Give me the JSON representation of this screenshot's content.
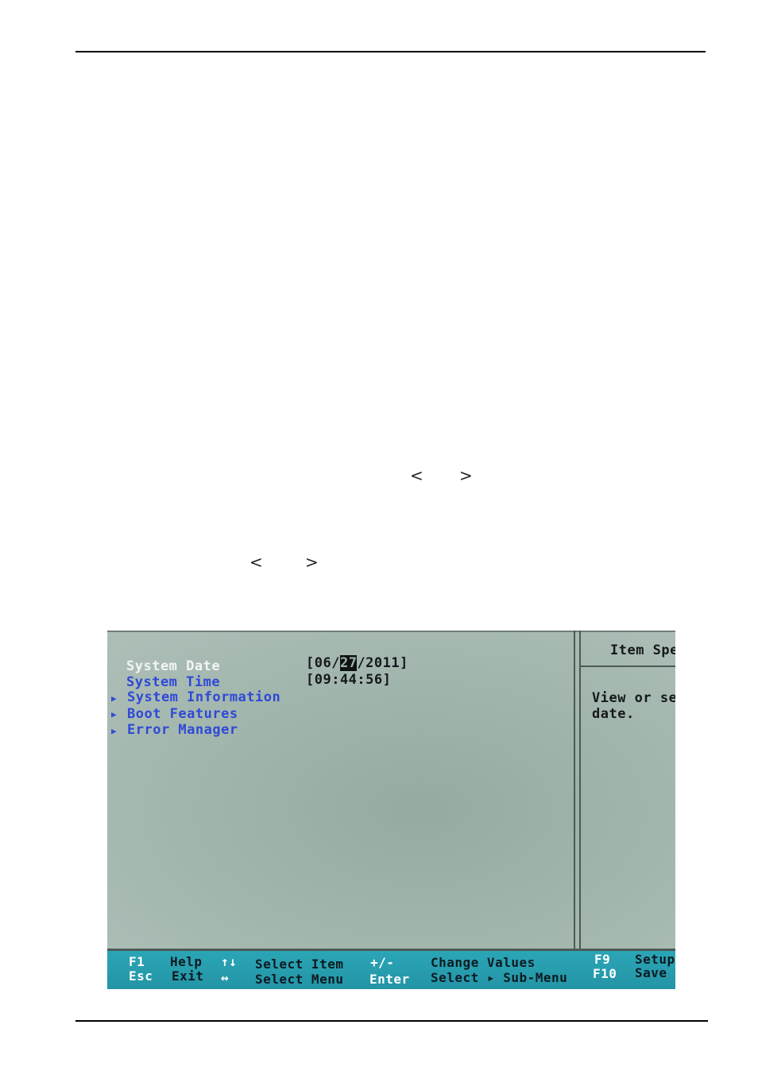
{
  "page": {
    "arrow_pair_1": {
      "left": "<",
      "right": ">"
    },
    "arrow_pair_2": {
      "left": "<",
      "right": ">"
    }
  },
  "bios": {
    "menu": [
      {
        "label": "System Date",
        "value": "[06/27/2011]",
        "selected": true,
        "submenu": false
      },
      {
        "label": "System Time",
        "value": "[09:44:56]",
        "selected": false,
        "submenu": false
      },
      {
        "label": "System Information",
        "value": "",
        "selected": false,
        "submenu": true
      },
      {
        "label": "Boot Features",
        "value": "",
        "selected": false,
        "submenu": true
      },
      {
        "label": "Error Manager",
        "value": "",
        "selected": false,
        "submenu": true
      }
    ],
    "date": {
      "prefix": "[06/",
      "highlight": "27",
      "suffix": "/2011]"
    },
    "submenu_arrow_icon": "triangle-right",
    "help_panel": {
      "title": "Item Spe",
      "lines": [
        "View or se",
        "date."
      ]
    },
    "keybar": {
      "row1": [
        {
          "key": "F1",
          "action": "Help"
        },
        {
          "key": "↑↓",
          "action": "Select Item"
        },
        {
          "key": "+/-",
          "action": "Change Values"
        },
        {
          "key": "F9",
          "action": "Setup"
        }
      ],
      "row2": [
        {
          "key": "Esc",
          "action": "Exit"
        },
        {
          "key": "↔",
          "action": "Select Menu"
        },
        {
          "key": "Enter",
          "action": "Select ▸ Sub-Menu"
        },
        {
          "key": "F10",
          "action": "Save"
        }
      ]
    },
    "colors": {
      "selected_item": "#f2f4f8",
      "menu_item": "#2f49d6",
      "keybar_bg": "#2ba6b6",
      "screen_bg": "#9fb4ab"
    }
  }
}
